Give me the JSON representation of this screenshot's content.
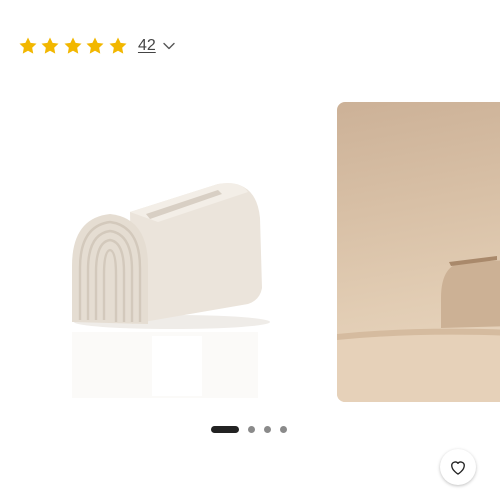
{
  "rating": {
    "value": 5,
    "max": 5,
    "star_color": "#f2b700",
    "review_count": "42"
  },
  "gallery": {
    "slides": [
      {
        "icon": "tissue-box-product-photo"
      },
      {
        "icon": "tissue-box-lifestyle-photo"
      }
    ],
    "active_slide": 1,
    "total_slides": 4,
    "wishlist_icon": "heart-icon"
  }
}
